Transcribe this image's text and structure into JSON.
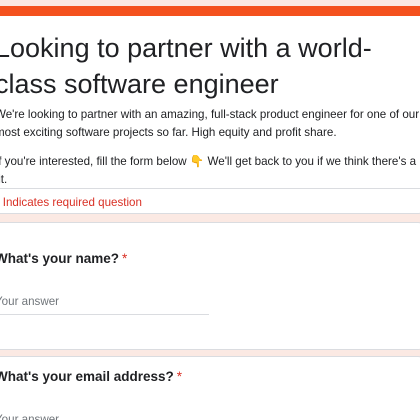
{
  "header": {
    "title": "Looking to partner with a world-class software engineer",
    "description_1": "We're looking to partner with an amazing, full-stack product engineer for one of our most exciting software projects so far. High equity and profit share.",
    "description_2": "If you're interested, fill the form below 👇 We'll get back to you if we think there's a fit.",
    "required_note": "* Indicates required question"
  },
  "questions": [
    {
      "label": "What's your name?",
      "required_mark": "*",
      "placeholder": "Your answer",
      "value": ""
    },
    {
      "label": "What's your email address?",
      "required_mark": "*",
      "placeholder": "Your answer",
      "value": ""
    }
  ],
  "colors": {
    "accent": "#f4511e",
    "page_background": "#fbe9e3",
    "required": "#d93025"
  }
}
